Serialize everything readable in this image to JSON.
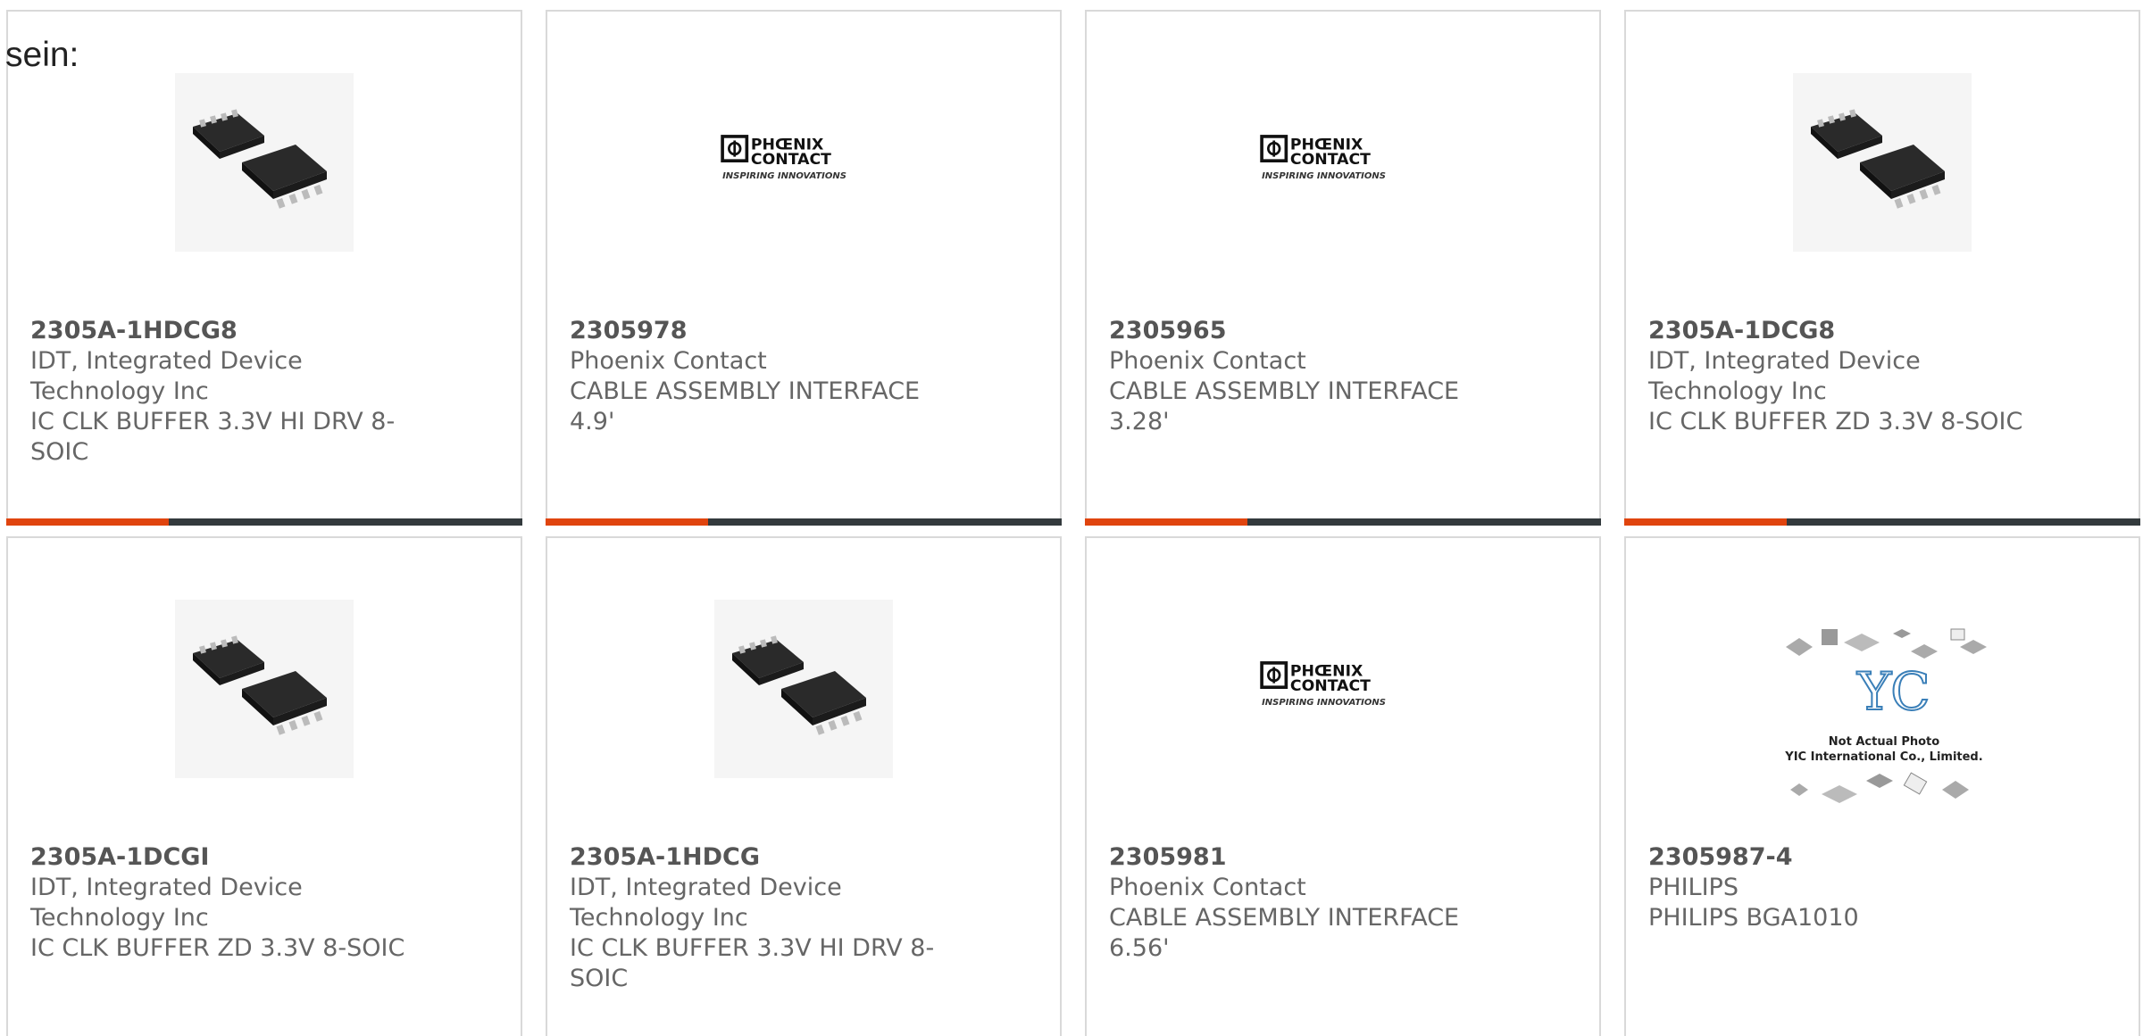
{
  "stray_text": "sein:",
  "colors": {
    "accent": "#e0440e",
    "bar": "#333a3d",
    "card_border": "#d9d9d9",
    "text": "#666666"
  },
  "products": [
    {
      "part_number": "2305A-1HDCG8",
      "manufacturer": "IDT, Integrated Device Technology Inc",
      "description": "IC CLK BUFFER 3.3V HI DRV 8-SOIC",
      "image": "soic-8-chip-icon"
    },
    {
      "part_number": "2305978",
      "manufacturer": "Phoenix Contact",
      "description": "CABLE ASSEMBLY INTERFACE 4.9'",
      "image": "phoenix-contact-logo",
      "logo_line1": "PHŒNIX",
      "logo_line2": "CONTACT",
      "logo_tagline": "INSPIRING INNOVATIONS"
    },
    {
      "part_number": "2305965",
      "manufacturer": "Phoenix Contact",
      "description": "CABLE ASSEMBLY INTERFACE 3.28'",
      "image": "phoenix-contact-logo",
      "logo_line1": "PHŒNIX",
      "logo_line2": "CONTACT",
      "logo_tagline": "INSPIRING INNOVATIONS"
    },
    {
      "part_number": "2305A-1DCG8",
      "manufacturer": "IDT, Integrated Device Technology Inc",
      "description": "IC CLK BUFFER ZD 3.3V 8-SOIC",
      "image": "soic-8-chip-icon"
    },
    {
      "part_number": "2305A-1DCGI",
      "manufacturer": "IDT, Integrated Device Technology Inc",
      "description": "IC CLK BUFFER ZD 3.3V 8-SOIC",
      "image": "soic-8-chip-icon"
    },
    {
      "part_number": "2305A-1HDCG",
      "manufacturer": "IDT, Integrated Device Technology Inc",
      "description": "IC CLK BUFFER 3.3V HI DRV 8-SOIC",
      "image": "soic-8-chip-icon"
    },
    {
      "part_number": "2305981",
      "manufacturer": "Phoenix Contact",
      "description": "CABLE ASSEMBLY INTERFACE 6.56'",
      "image": "phoenix-contact-logo",
      "logo_line1": "PHŒNIX",
      "logo_line2": "CONTACT",
      "logo_tagline": "INSPIRING INNOVATIONS"
    },
    {
      "part_number": "2305987-4",
      "manufacturer": "PHILIPS",
      "description": "PHILIPS BGA1010",
      "image": "yic-placeholder-image",
      "placeholder_line1": "Not Actual Photo",
      "placeholder_line2": "YIC International Co., Limited."
    }
  ]
}
